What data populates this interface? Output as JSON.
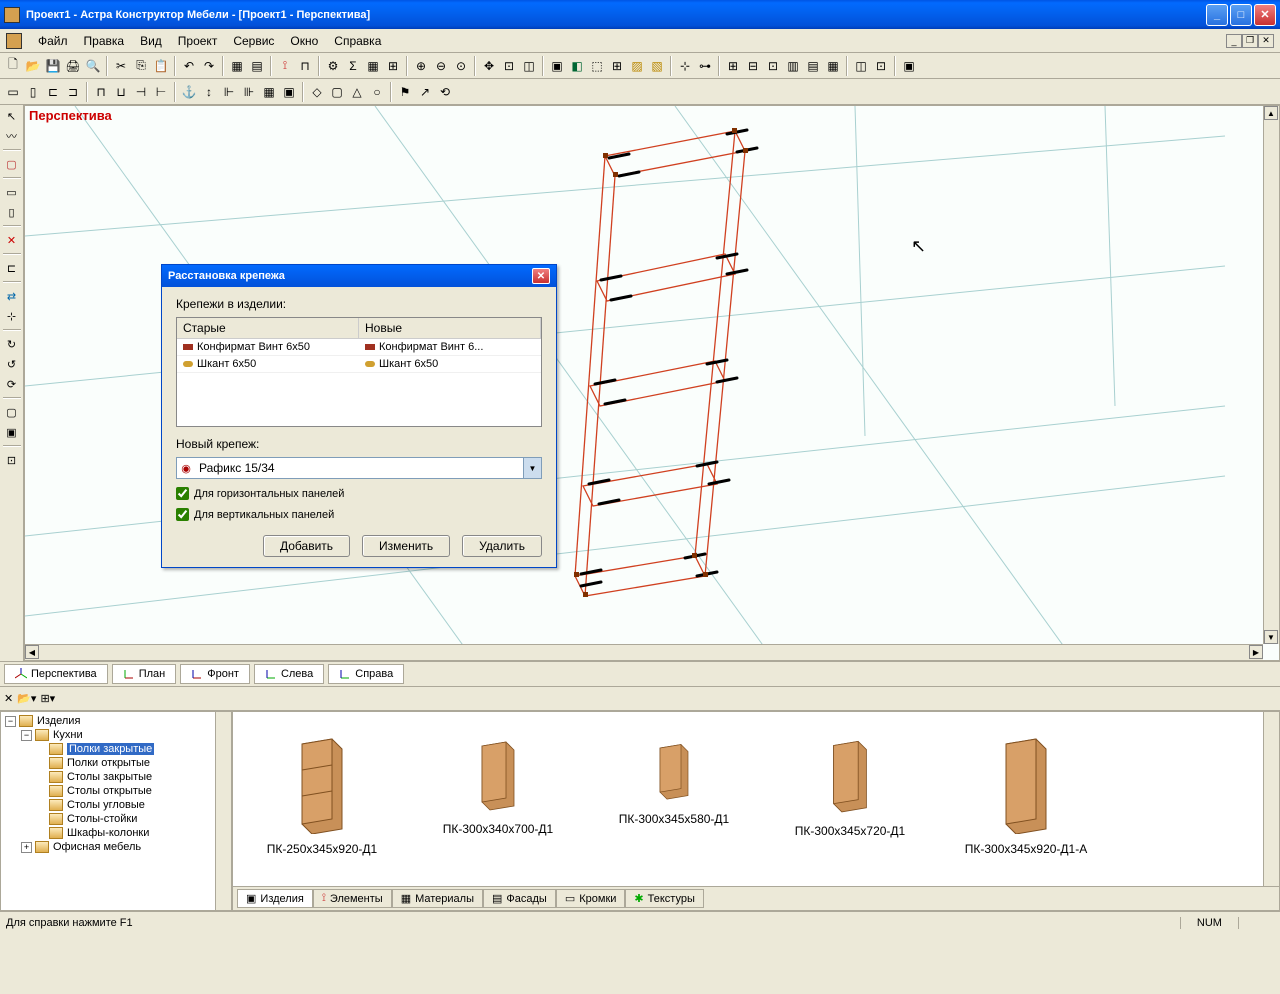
{
  "title": "Проект1 - Астра Конструктор Мебели - [Проект1 - Перспектива]",
  "menu": {
    "file": "Файл",
    "edit": "Правка",
    "view": "Вид",
    "project": "Проект",
    "service": "Сервис",
    "window": "Окно",
    "help": "Справка"
  },
  "viewport_label": "Перспектива",
  "view_tabs": {
    "persp": "Перспектива",
    "plan": "План",
    "front": "Фронт",
    "left": "Слева",
    "right": "Справа"
  },
  "dialog": {
    "title": "Расстановка крепежа",
    "items_label": "Крепежи в изделии:",
    "col_old": "Старые",
    "col_new": "Новые",
    "rows": [
      {
        "old": "Конфирмат Винт 6x50",
        "new": "Конфирмат Винт 6..."
      },
      {
        "old": "Шкант 6x50",
        "new": "Шкант 6x50"
      }
    ],
    "new_label": "Новый крепеж:",
    "combo": "Рафикс 15/34",
    "chk_h": "Для горизонтальных панелей",
    "chk_v": "Для вертикальных панелей",
    "btn_add": "Добавить",
    "btn_edit": "Изменить",
    "btn_del": "Удалить"
  },
  "tree": {
    "root": "Изделия",
    "kitchens": "Кухни",
    "items": [
      "Полки закрытые",
      "Полки открытые",
      "Столы закрытые",
      "Столы открытые",
      "Столы угловые",
      "Столы-стойки",
      "Шкафы-колонки"
    ],
    "office": "Офисная мебель"
  },
  "thumbs": [
    "ПК-250x345x920-Д1",
    "ПК-300x340x700-Д1",
    "ПК-300x345x580-Д1",
    "ПК-300x345x720-Д1",
    "ПК-300x345x920-Д1-А"
  ],
  "bottom_tabs": {
    "izd": "Изделия",
    "elem": "Элементы",
    "mat": "Материалы",
    "fas": "Фасады",
    "krom": "Кромки",
    "tex": "Текстуры"
  },
  "status": {
    "help": "Для справки нажмите F1",
    "num": "NUM"
  }
}
